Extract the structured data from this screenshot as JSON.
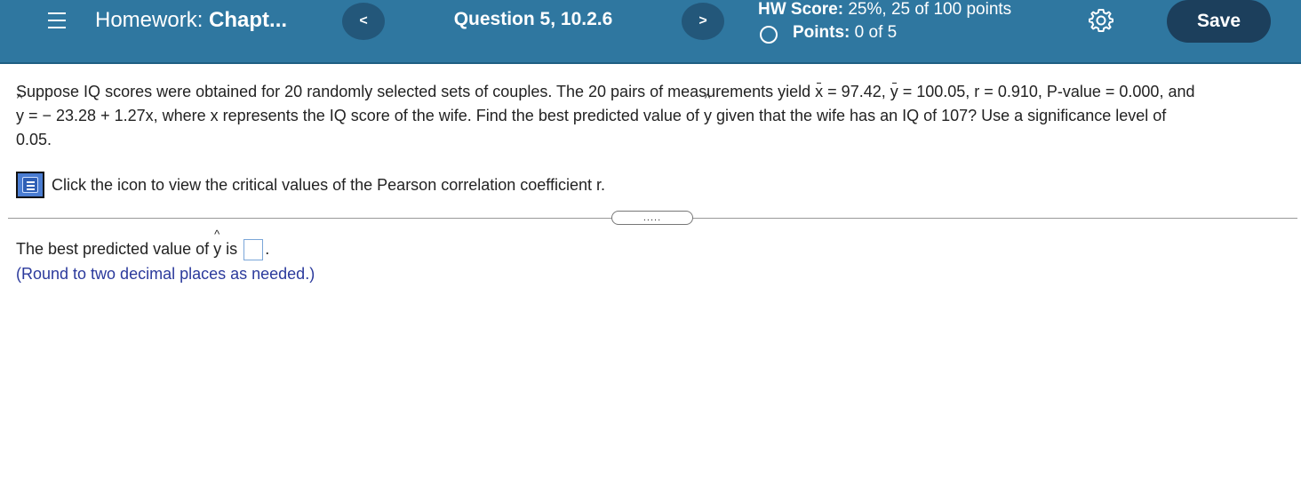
{
  "header": {
    "homework_prefix": "Homework:",
    "homework_title": "Chapt...",
    "prev_label": "<",
    "question_label": "Question 5, 10.2.6",
    "next_label": ">",
    "hw_score_label": "HW Score:",
    "hw_score_value": "25%, 25 of 100 points",
    "points_label": "Points:",
    "points_value": "0 of 5",
    "save_label": "Save"
  },
  "problem": {
    "p1": "Suppose IQ scores were obtained for 20 randomly selected sets of couples. The 20 pairs of measurements yield",
    "x_var": "x",
    "x_val": " = 97.42, ",
    "y_var": "y",
    "y_val": " = 100.05, r = 0.910, P-value = 0.000, and",
    "yhat_var": "y",
    "eq": " =  − 23.28 + 1.27x, where x represents the IQ score of the wife. Find the best predicted value of",
    "yhat2_var": "y",
    "p2": " given that the wife has an IQ of 107? Use a significance level of",
    "p3": "0.05."
  },
  "resource_link": "Click the icon to view the critical values of the Pearson correlation coefficient r.",
  "expand_label": ".....",
  "answer": {
    "prefix": "The best predicted value of",
    "yhat_var": "y",
    "is": "is",
    "value": "",
    "period": ".",
    "note": "(Round to two decimal places as needed.)"
  }
}
